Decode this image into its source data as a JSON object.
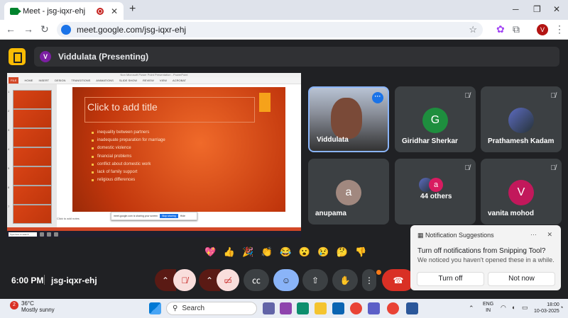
{
  "browser": {
    "tab_title": "Meet - jsg-iqxr-ehj",
    "url": "meet.google.com/jsg-iqxr-ehj",
    "profile_initial": "V"
  },
  "presenter": {
    "initial": "V",
    "label": "Viddulata (Presenting)"
  },
  "presentation": {
    "window_title": "Non Microsoft Power Point Presentation - PowerPoint",
    "ribbon_tabs": [
      "FILE",
      "HOME",
      "INSERT",
      "DESIGN",
      "TRANSITIONS",
      "ANIMATIONS",
      "SLIDE SHOW",
      "REVIEW",
      "VIEW",
      "ACROBAT"
    ],
    "slide_title": "Click to add title",
    "bullets": [
      "inequality between partners",
      "inadequate preparation for marriage",
      "domestic violence",
      "financial problems",
      "conflict about domestic work",
      "lack of family support",
      "religious differences"
    ],
    "share_banner": {
      "text": "meet.google.com is sharing your screen",
      "stop": "Stop sharing",
      "hide": "Hide"
    },
    "notes": "Click to add notes",
    "inner_search": "Type here to search",
    "slide_numbers": [
      "1",
      "2",
      "3",
      "4",
      "5",
      "6",
      "7"
    ]
  },
  "participants": [
    {
      "name": "Viddulata",
      "type": "video"
    },
    {
      "name": "Giridhar Sherkar",
      "initial": "G",
      "color": "#1e8e3e"
    },
    {
      "name": "Prathamesh Kadam",
      "type": "photo"
    },
    {
      "name": "anupama",
      "initial": "a",
      "color": "#a1887f"
    },
    {
      "name": "44 others",
      "initial": "a",
      "color": "#d81b60"
    },
    {
      "name": "vanita mohod",
      "initial": "V",
      "color": "#c2185b"
    }
  ],
  "reactions": [
    "💖",
    "👍",
    "🎉",
    "👏",
    "😂",
    "😮",
    "😢",
    "🤔",
    "👎"
  ],
  "meeting": {
    "time": "6:00 PM",
    "code": "jsg-iqxr-ehj"
  },
  "notification": {
    "header": "Notification Suggestions",
    "title": "Turn off notifications from Snipping Tool?",
    "subtitle": "We noticed you haven't opened these in a while.",
    "turn_off": "Turn off",
    "not_now": "Not now"
  },
  "taskbar": {
    "weather_badge": "2",
    "temp": "36°C",
    "weather": "Mostly sunny",
    "search": "Search",
    "lang1": "ENG",
    "lang2": "IN",
    "time": "18:00",
    "date": "10-03-2025"
  }
}
